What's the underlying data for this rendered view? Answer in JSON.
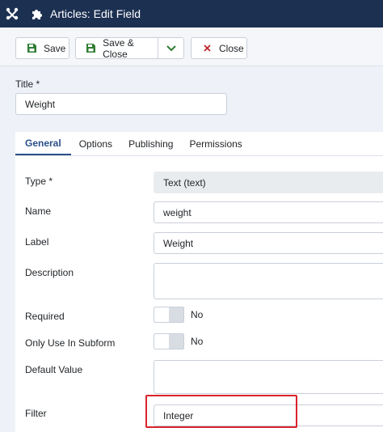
{
  "header": {
    "title": "Articles: Edit Field"
  },
  "toolbar": {
    "save_label": "Save",
    "save_close_label": "Save & Close",
    "close_label": "Close"
  },
  "title_field": {
    "label": "Title *",
    "value": "Weight"
  },
  "tabs": [
    {
      "label": "General",
      "active": true
    },
    {
      "label": "Options",
      "active": false
    },
    {
      "label": "Publishing",
      "active": false
    },
    {
      "label": "Permissions",
      "active": false
    }
  ],
  "fields": {
    "type": {
      "label": "Type *",
      "value": "Text (text)"
    },
    "name": {
      "label": "Name",
      "value": "weight"
    },
    "label": {
      "label": "Label",
      "value": "Weight"
    },
    "description": {
      "label": "Description",
      "value": ""
    },
    "required": {
      "label": "Required",
      "state": "No"
    },
    "only_subform": {
      "label": "Only Use In Subform",
      "state": "No"
    },
    "default_value": {
      "label": "Default Value",
      "value": ""
    },
    "filter": {
      "label": "Filter",
      "value": "Integer"
    }
  },
  "colors": {
    "topbar": "#1c3052",
    "save_icon": "#2f7d32",
    "close_icon": "#c0232c",
    "highlight": "#d9232d",
    "active_tab": "#2a4e8a"
  }
}
